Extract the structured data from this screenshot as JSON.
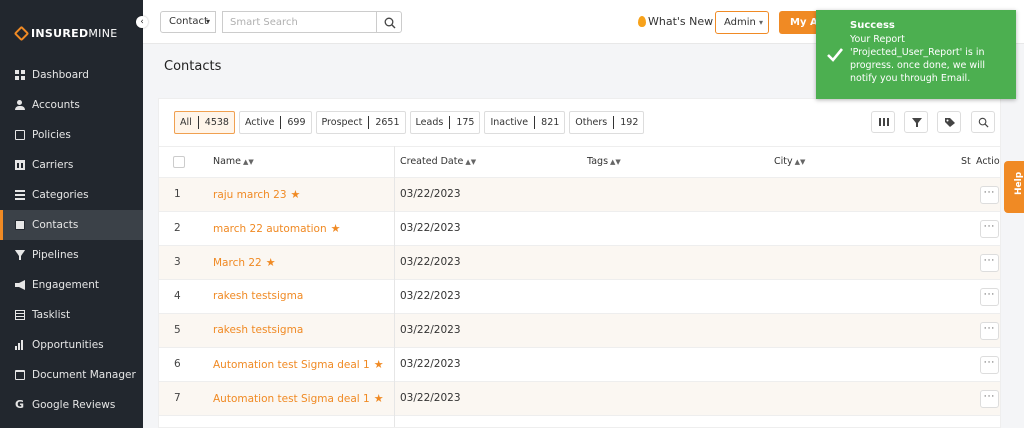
{
  "brand": {
    "name_bold": "INSURED",
    "name_light": "MINE",
    "accent": "#f08a24",
    "sidebar_bg": "#22272e"
  },
  "sidebar": {
    "collapse_icon": "chevron-left-icon",
    "items": [
      {
        "label": "Dashboard",
        "icon": "grid-icon"
      },
      {
        "label": "Accounts",
        "icon": "users-icon"
      },
      {
        "label": "Policies",
        "icon": "document-icon"
      },
      {
        "label": "Carriers",
        "icon": "bank-icon"
      },
      {
        "label": "Categories",
        "icon": "list-icon"
      },
      {
        "label": "Contacts",
        "icon": "contact-card-icon",
        "active": true
      },
      {
        "label": "Pipelines",
        "icon": "funnel-icon"
      },
      {
        "label": "Engagement",
        "icon": "megaphone-icon"
      },
      {
        "label": "Tasklist",
        "icon": "tasklist-icon"
      },
      {
        "label": "Opportunities",
        "icon": "bar-chart-icon"
      },
      {
        "label": "Document Manager",
        "icon": "folder-icon"
      },
      {
        "label": "Google Reviews",
        "icon": "google-icon"
      }
    ]
  },
  "topbar": {
    "search_type": "Contact",
    "search_placeholder": "Smart Search",
    "whats_new": "What's New",
    "role": "Admin",
    "agency_button": "My Agency"
  },
  "toast": {
    "title": "Success",
    "message": "Your Report 'Projected_User_Report' is in progress. once done, we will notify you through Email.",
    "color": "#4caf50"
  },
  "page": {
    "title": "Contacts"
  },
  "filters": [
    {
      "label": "All",
      "count": "4538",
      "active": true
    },
    {
      "label": "Active",
      "count": "699"
    },
    {
      "label": "Prospect",
      "count": "2651"
    },
    {
      "label": "Leads",
      "count": "175"
    },
    {
      "label": "Inactive",
      "count": "821"
    },
    {
      "label": "Others",
      "count": "192"
    }
  ],
  "toolbar_icons": [
    "columns-icon",
    "filter-icon",
    "tag-icon",
    "search-icon"
  ],
  "table": {
    "columns": {
      "name": "Name",
      "created": "Created Date",
      "tags": "Tags",
      "city": "City",
      "status": "St",
      "action": "Action"
    },
    "rows": [
      {
        "num": "1",
        "name": "raju march 23",
        "starred": true,
        "date": "03/22/2023"
      },
      {
        "num": "2",
        "name": "march 22 automation",
        "starred": true,
        "date": "03/22/2023"
      },
      {
        "num": "3",
        "name": "March 22",
        "starred": true,
        "date": "03/22/2023"
      },
      {
        "num": "4",
        "name": "rakesh testsigma",
        "starred": false,
        "date": "03/22/2023"
      },
      {
        "num": "5",
        "name": "rakesh testsigma",
        "starred": false,
        "date": "03/22/2023"
      },
      {
        "num": "6",
        "name": "Automation test Sigma deal 1",
        "starred": true,
        "date": "03/22/2023"
      },
      {
        "num": "7",
        "name": "Automation test Sigma deal 1",
        "starred": true,
        "date": "03/22/2023"
      }
    ],
    "action_label": "···"
  },
  "help": {
    "label": "Help"
  }
}
